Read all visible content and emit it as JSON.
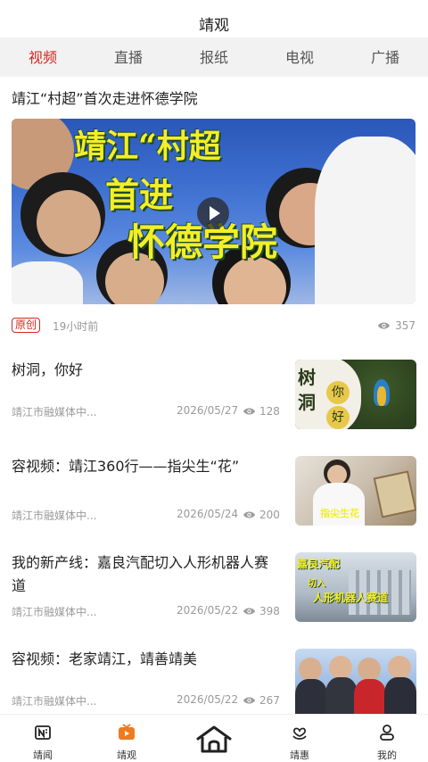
{
  "header": {
    "title": "靖观"
  },
  "tabs": [
    {
      "label": "视频",
      "active": true
    },
    {
      "label": "直播",
      "active": false
    },
    {
      "label": "报纸",
      "active": false
    },
    {
      "label": "电视",
      "active": false
    },
    {
      "label": "广播",
      "active": false
    }
  ],
  "featured": {
    "title": "靖江“村超”首次走进怀德学院",
    "caption_line1": "靖江“村超",
    "caption_line2": "首进",
    "caption_line3": "怀德学院",
    "badge": "原创",
    "time_ago": "19小时前",
    "views": "357"
  },
  "items": [
    {
      "title": "树洞，你好",
      "source": "靖江市融媒体中...",
      "date": "2026/05/27",
      "views": "128",
      "thumb_caption_a": "树",
      "thumb_caption_b": "洞",
      "thumb_caption_c": "你",
      "thumb_caption_d": "好"
    },
    {
      "title": "容视频：靖江360行——指尖生“花”",
      "source": "靖江市融媒体中...",
      "date": "2026/05/24",
      "views": "200",
      "thumb_caption_a": "指尖生花"
    },
    {
      "title": "我的新产线：嘉良汽配切入人形机器人赛道",
      "source": "靖江市融媒体中...",
      "date": "2026/05/22",
      "views": "398",
      "thumb_caption_a": "嘉良汽配",
      "thumb_caption_b": "切入",
      "thumb_caption_c": "人形机器人赛道"
    },
    {
      "title": "容视频：老家靖江，靖善靖美",
      "source": "靖江市融媒体中...",
      "date": "2026/05/22",
      "views": "267"
    }
  ],
  "tabbar": [
    {
      "label": "靖闻",
      "icon": "news-icon"
    },
    {
      "label": "靖观",
      "icon": "video-play-icon"
    },
    {
      "label": "",
      "icon": "home-icon"
    },
    {
      "label": "靖惠",
      "icon": "heart-hands-icon"
    },
    {
      "label": "我的",
      "icon": "user-icon"
    }
  ],
  "colors": {
    "accent": "#d4271f",
    "tab_bg": "#f2f2f2",
    "muted": "#9a9a9a"
  }
}
